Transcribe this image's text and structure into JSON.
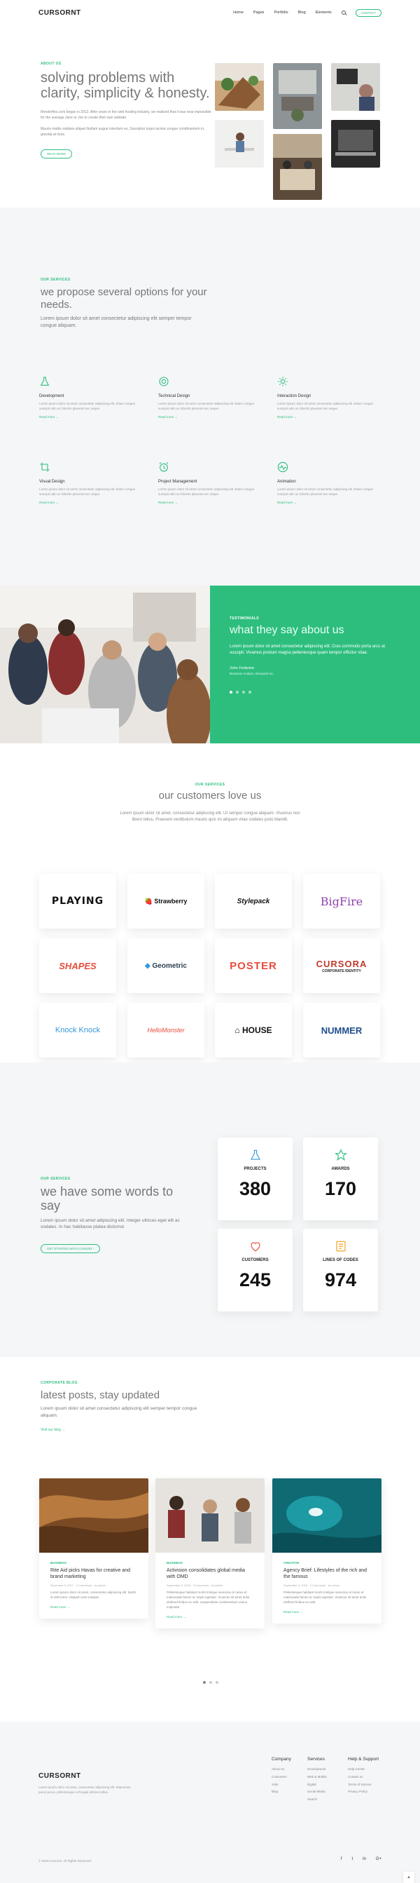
{
  "header": {
    "logo": "CURSORNT",
    "nav": [
      "Home",
      "Pages",
      "Portfolio",
      "Blog",
      "Elements"
    ],
    "contact_label": "CONTACT"
  },
  "about": {
    "kicker": "ABOUT US",
    "title": "solving problems with clarity, simplicity & honesty.",
    "p1": "Renderfino.com began in 2012. After years in the web hosting industry, we realized that it was near impossible for the average Jane or Joe to create their own website.",
    "p2": "Mauris mattis sodales aliquet.Nullam augue interdum eu, Suscipitur turpis lacinia congue condimentum in, gravida at risus.",
    "button": "READ MORE"
  },
  "options": {
    "kicker": "OUR SERVICES",
    "title": "we propose several options for your needs.",
    "lead": "Lorem ipsum dolor sit amet consectetur adipiscing elit semper tempor congue aliquam.",
    "items": [
      {
        "icon": "flask-icon",
        "title": "Development",
        "desc": "Lorem ipsum dolor sit amet consectetur adipiscing elit. Etiam congue suscipit odio ac lobortis placerat nec neque.",
        "more": "Read more →"
      },
      {
        "icon": "target-icon",
        "title": "Technical Design",
        "desc": "Lorem ipsum dolor sit amet consectetur adipiscing elit. Etiam congue suscipit odio ac lobortis placerat nec neque.",
        "more": "Read more →"
      },
      {
        "icon": "sun-icon",
        "title": "Interaction Design",
        "desc": "Lorem ipsum dolor sit amet consectetur adipiscing elit. Etiam congue suscipit odio ac lobortis placerat nec neque.",
        "more": "Read more →"
      },
      {
        "icon": "crop-icon",
        "title": "Visual Design",
        "desc": "Lorem ipsum dolor sit amet consectetur adipiscing elit. Etiam congue suscipit odio ac lobortis placerat nec neque.",
        "more": "Read more →"
      },
      {
        "icon": "alarm-icon",
        "title": "Project Management",
        "desc": "Lorem ipsum dolor sit amet consectetur adipiscing elit. Etiam congue suscipit odio ac lobortis placerat nec neque.",
        "more": "Read more →"
      },
      {
        "icon": "activity-icon",
        "title": "Animation",
        "desc": "Lorem ipsum dolor sit amet consectetur adipiscing elit. Etiam congue suscipit odio ac lobortis placerat nec neque.",
        "more": "Read more →"
      }
    ]
  },
  "testimonials": {
    "kicker": "TESTIMONIALS",
    "title": "what they say about us",
    "quote": "Lorem ipsum dolor sit amet consectetur adipiscing elit. Cras commodo porta arcu at suscipit. Vivamus pretium magna pellentesque quam tempor efficitur vitae.",
    "name": "John Federine",
    "role": "Business Analyst, Stoxpoint Inc."
  },
  "clients": {
    "kicker": "OUR SERVICES",
    "title": "our customers love us",
    "lead": "Lorem ipsum dolor sit amet, consectetur adipiscing elit. Ut semper congue aliquam. Vivamus non libero tellus. Praesent vestibulum mauris quis mi aliquam vitae sodales justo blandit.",
    "logos": [
      {
        "text": "PLAYING",
        "color": "#111111"
      },
      {
        "text": "Strawberry",
        "color": "#111111"
      },
      {
        "text": "Stylepack",
        "color": "#111111"
      },
      {
        "text": "BigFire",
        "color": "#9b59b6"
      },
      {
        "text": "SHAPES",
        "color": "#e74c3c"
      },
      {
        "text": "Geometric",
        "color": "#2c3e50"
      },
      {
        "text": "POSTER",
        "color": "#e74c3c"
      },
      {
        "text": "CURSORA",
        "color": "#c0392b"
      },
      {
        "text": "Knock Knock",
        "color": "#3498db"
      },
      {
        "text": "HelloMonster",
        "color": "#e74c3c"
      },
      {
        "text": "HOUSE",
        "color": "#111111"
      },
      {
        "text": "NUMMER",
        "color": "#1f4e8c"
      }
    ],
    "sub": "CORPORATE IDENTITY"
  },
  "stats": {
    "kicker": "OUR SERVICES",
    "title": "we have some words to say",
    "lead": "Lorem ipsum dolor sit amet adipiscing elit. Integer ultrices eget elit ac sodales. In hac habitasse platea dictumst.",
    "button": "GET STARTED WITH CURSOR ›",
    "items": [
      {
        "icon": "flask-icon",
        "label": "PROJECTS",
        "value": "380"
      },
      {
        "icon": "star-icon",
        "label": "AWARDS",
        "value": "170"
      },
      {
        "icon": "heart-icon",
        "label": "CUSTOMERS",
        "value": "245"
      },
      {
        "icon": "file-icon",
        "label": "LINES OF CODES",
        "value": "974"
      }
    ]
  },
  "blog": {
    "kicker": "CORPORATE BLOG",
    "title": "latest posts, stay updated",
    "lead": "Lorem ipsum dolor sit amet consectetur adipiscing elit semper tempor congue aliquam.",
    "visit": "Visit our blog →",
    "posts": [
      {
        "cat": "BUSINESS",
        "title": "Rite Aid picks Havas for creative and brand marketing",
        "meta": "November 3, 2017 · 3 Comments · by admin",
        "ex": "Lorem ipsum dolor sit amet, consectetur adipiscing elit. Morbi id velit tortor. Aliquam erat volutpat.",
        "more": "Read more →"
      },
      {
        "cat": "BUSINESS",
        "title": "Activision consolidates global media with OMD",
        "meta": "September 5, 2018 · 3 Comments · by admin",
        "ex": "Pellentesque habitant morbi tristique senectus et netus et malesuada fames ac turpis egestas. Vivamus sit amet dolor eleifend finibus ex velit. Suspendisse condimentum varius vulputate.",
        "more": "Read more →"
      },
      {
        "cat": "CREATIVE",
        "title": "Agency Brief: Lifestyles of the rich and the famous",
        "meta": "September 3, 2018 · 3 Comments · by admin",
        "ex": "Pellentesque habitant morbi tristique senectus et netus et malesuada fames ac turpis egestas. Vivamus sit amet dolor eleifend finibus ex velit.",
        "more": "Read more →"
      }
    ]
  },
  "footer": {
    "logo": "CURSORNT",
    "desc": "Lorem ipsum dolor sit amet, consectetur adipiscing elit. Maecenas purus purus, pellentesque ut feugiat ultrices tellus.",
    "cols": [
      {
        "title": "Company",
        "items": [
          "About Us",
          "Customers",
          "Jobs",
          "Blog"
        ]
      },
      {
        "title": "Services",
        "items": [
          "Development",
          "Web & Mobile",
          "Digital",
          "Social Media",
          "Search"
        ]
      },
      {
        "title": "Help & Support",
        "items": [
          "Help Center",
          "Contact us",
          "Terms of Service",
          "Privacy Policy"
        ]
      }
    ],
    "copyright": "2018 Cursornt. All Rights Reserved.",
    "social": [
      "f",
      "t",
      "in",
      "G+"
    ]
  },
  "colors": {
    "accent": "#2dbe7e",
    "bg_light": "#f4f6f7"
  }
}
